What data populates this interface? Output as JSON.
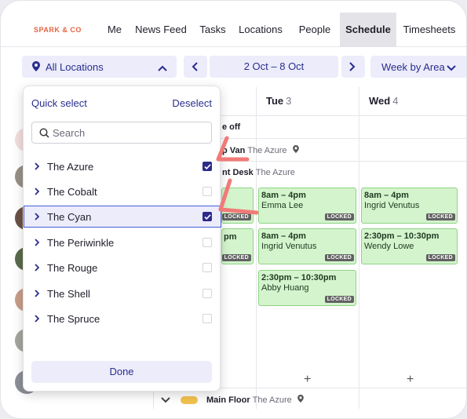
{
  "brand": {
    "logo": "SPARK & CO"
  },
  "nav": {
    "tabs": [
      {
        "label": "Me"
      },
      {
        "label": "News Feed"
      },
      {
        "label": "Tasks"
      },
      {
        "label": "Locations"
      },
      {
        "label": "People"
      },
      {
        "label": "Schedule",
        "active": true
      },
      {
        "label": "Timesheets"
      }
    ]
  },
  "toolbar": {
    "location_filter": "All Locations",
    "date_range": "2 Oct – 8 Oct",
    "view_mode": "Week by Area"
  },
  "schedule": {
    "days": [
      {
        "name": "Tue",
        "num": "3"
      },
      {
        "name": "Wed",
        "num": "4"
      }
    ],
    "rows": {
      "time_off": "e off",
      "area1": {
        "name": "p Van",
        "location": "The Azure"
      },
      "area2": {
        "name": "nt Desk",
        "location": "The Azure"
      },
      "main_floor": {
        "name": "Main Floor",
        "location": "The Azure"
      }
    },
    "partial_times": [
      "pm",
      "pm"
    ],
    "shifts": [
      {
        "time": "8am – 4pm",
        "name": "Emma Lee",
        "badge": "LOCKED"
      },
      {
        "time": "8am – 4pm",
        "name": "Ingrid Venutus",
        "badge": "LOCKED"
      },
      {
        "time": "8am – 4pm",
        "name": "Ingrid Venutus",
        "badge": "LOCKED"
      },
      {
        "time": "2:30pm – 10:30pm",
        "name": "Wendy Lowe",
        "badge": "LOCKED"
      },
      {
        "time": "2:30pm – 10:30pm",
        "name": "Abby Huang",
        "badge": "LOCKED"
      }
    ],
    "partial_badges": [
      "LOCKED",
      "LOCKED"
    ],
    "add_symbol": "+"
  },
  "dropdown": {
    "quick_select": "Quick select",
    "deselect": "Deselect",
    "search_placeholder": "Search",
    "locations": [
      {
        "label": "The Azure",
        "checked": true
      },
      {
        "label": "The Cobalt",
        "checked": false
      },
      {
        "label": "The Cyan",
        "checked": true,
        "highlighted": true
      },
      {
        "label": "The Periwinkle",
        "checked": false
      },
      {
        "label": "The Rouge",
        "checked": false
      },
      {
        "label": "The Shell",
        "checked": false
      },
      {
        "label": "The Spruce",
        "checked": false
      }
    ],
    "done": "Done"
  },
  "colors": {
    "accent": "#2a2e8c",
    "pill_bg": "#ececfb",
    "shift_bg": "#d4f4cd",
    "shift_border": "#8fd384",
    "annotation_arrow": "#f07a78",
    "brand": "#e8633f"
  }
}
